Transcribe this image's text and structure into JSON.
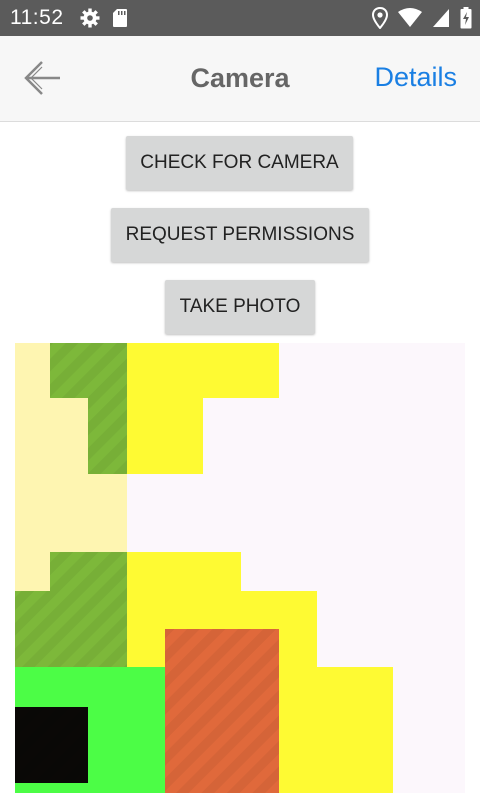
{
  "status_bar": {
    "time": "11:52",
    "icons_left": [
      "gear-icon",
      "sd-card-icon"
    ],
    "icons_right": [
      "location-icon",
      "wifi-icon",
      "signal-icon",
      "battery-charging-icon"
    ],
    "background": "#5b5b5b"
  },
  "nav": {
    "back_icon": "back-arrow-icon",
    "title": "Camera",
    "details_label": "Details",
    "accent": "#1a7fe3"
  },
  "buttons": {
    "check_camera": "CHECK FOR CAMERA",
    "request_permissions": "REQUEST PERMISSIONS",
    "take_photo": "TAKE PHOTO"
  },
  "photo": {
    "colors": {
      "background": "#fcf7fc",
      "cream": "#fef5b1",
      "olive": "#7db83a",
      "yellow": "#fefa33",
      "green": "#4cfd46",
      "orange": "#e0693b",
      "black": "#0a0806"
    }
  }
}
